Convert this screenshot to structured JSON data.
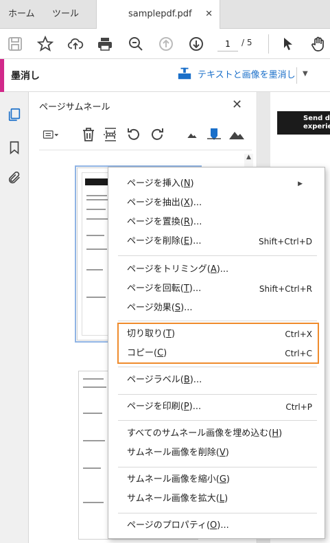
{
  "tabs": {
    "home": "ホーム",
    "tools": "ツール",
    "document": "samplepdf.pdf",
    "close": "✕"
  },
  "toolbar": {
    "current_page": "1",
    "total_pages": "/ 5"
  },
  "redact_bar": {
    "title": "墨消し",
    "action_label": "テキストと画像を墨消し",
    "caret": "▼"
  },
  "panel": {
    "title": "ページサムネール",
    "close": "✕"
  },
  "document_preview": {
    "banner_text_1": "Send do",
    "banner_text_2": "experien"
  },
  "context_menu": {
    "items": [
      {
        "label": "ページを挿入(",
        "key": "N",
        "suffix": ")",
        "shortcut": ""
      },
      {
        "label": "ページを抽出(",
        "key": "X",
        "suffix": ")...",
        "shortcut": ""
      },
      {
        "label": "ページを置換(",
        "key": "R",
        "suffix": ")...",
        "shortcut": ""
      },
      {
        "label": "ページを削除(",
        "key": "E",
        "suffix": ")...",
        "shortcut": "Shift+Ctrl+D"
      },
      {
        "label": "ページをトリミング(",
        "key": "A",
        "suffix": ")...",
        "shortcut": ""
      },
      {
        "label": "ページを回転(",
        "key": "T",
        "suffix": ")...",
        "shortcut": "Shift+Ctrl+R"
      },
      {
        "label": "ページ効果(",
        "key": "S",
        "suffix": ")...",
        "shortcut": ""
      },
      {
        "label": "切り取り(",
        "key": "T",
        "suffix": ")",
        "shortcut": "Ctrl+X"
      },
      {
        "label": "コピー(",
        "key": "C",
        "suffix": ")",
        "shortcut": "Ctrl+C"
      },
      {
        "label": "ページラベル(",
        "key": "B",
        "suffix": ")...",
        "shortcut": ""
      },
      {
        "label": "ページを印刷(",
        "key": "P",
        "suffix": ")...",
        "shortcut": "Ctrl+P"
      },
      {
        "label": "すべてのサムネール画像を埋め込む(",
        "key": "H",
        "suffix": ")",
        "shortcut": ""
      },
      {
        "label": "サムネール画像を削除(",
        "key": "V",
        "suffix": ")",
        "shortcut": ""
      },
      {
        "label": "サムネール画像を縮小(",
        "key": "G",
        "suffix": ")",
        "shortcut": ""
      },
      {
        "label": "サムネール画像を拡大(",
        "key": "L",
        "suffix": ")",
        "shortcut": ""
      },
      {
        "label": "ページのプロパティ(",
        "key": "O",
        "suffix": ")...",
        "shortcut": ""
      }
    ],
    "submenu_arrow": "▶",
    "highlight_color": "#ef8b2c"
  },
  "colors": {
    "accent_pink": "#d1298a",
    "link_blue": "#1a6fc9",
    "highlight_orange": "#ef8b2c"
  }
}
